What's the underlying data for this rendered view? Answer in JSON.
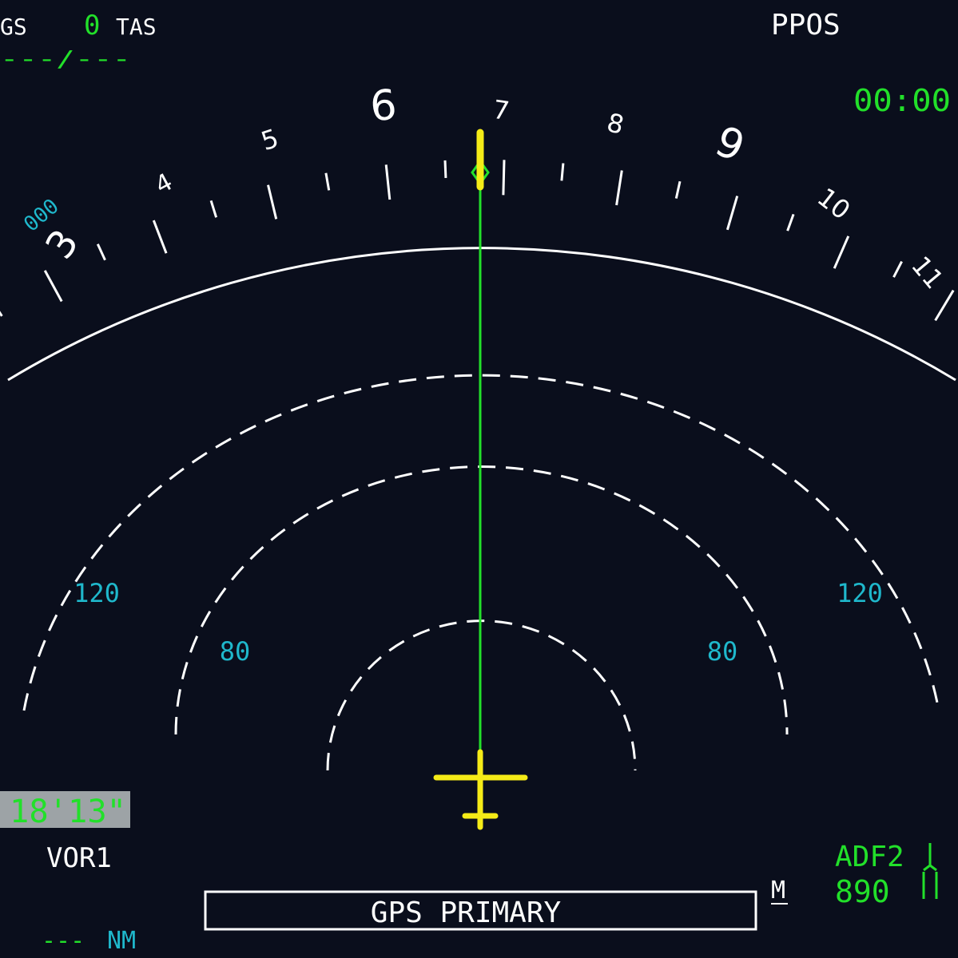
{
  "top_left": {
    "gs_label": "GS",
    "gs_value": "0",
    "tas_label": "TAS",
    "wind_value": "---/---"
  },
  "top_right": {
    "mode_label": "PPOS",
    "elapsed_time": "00:00"
  },
  "compass": {
    "heading_labels": [
      "3",
      "4",
      "5",
      "6",
      "7",
      "8",
      "9",
      "10",
      "11"
    ],
    "selected_heading": "000"
  },
  "range_rings": {
    "left_outer_label": "120",
    "right_outer_label": "120",
    "left_mid_label": "80",
    "right_mid_label": "80"
  },
  "bottom_left": {
    "chrono_value": "18'13\"",
    "nav_source_label": "VOR1",
    "distance_value": "---",
    "distance_unit": "NM"
  },
  "bottom_center": {
    "gps_message": "GPS PRIMARY",
    "mag_indicator": "M"
  },
  "bottom_right": {
    "adf_label": "ADF2",
    "adf_frequency": "890"
  },
  "colors": {
    "background": "#0a0e1c",
    "white": "#ffffff",
    "green": "#22e02a",
    "cyan": "#1fb8cc",
    "yellow": "#f5eb17",
    "chrono_bg": "#9da3a6"
  }
}
